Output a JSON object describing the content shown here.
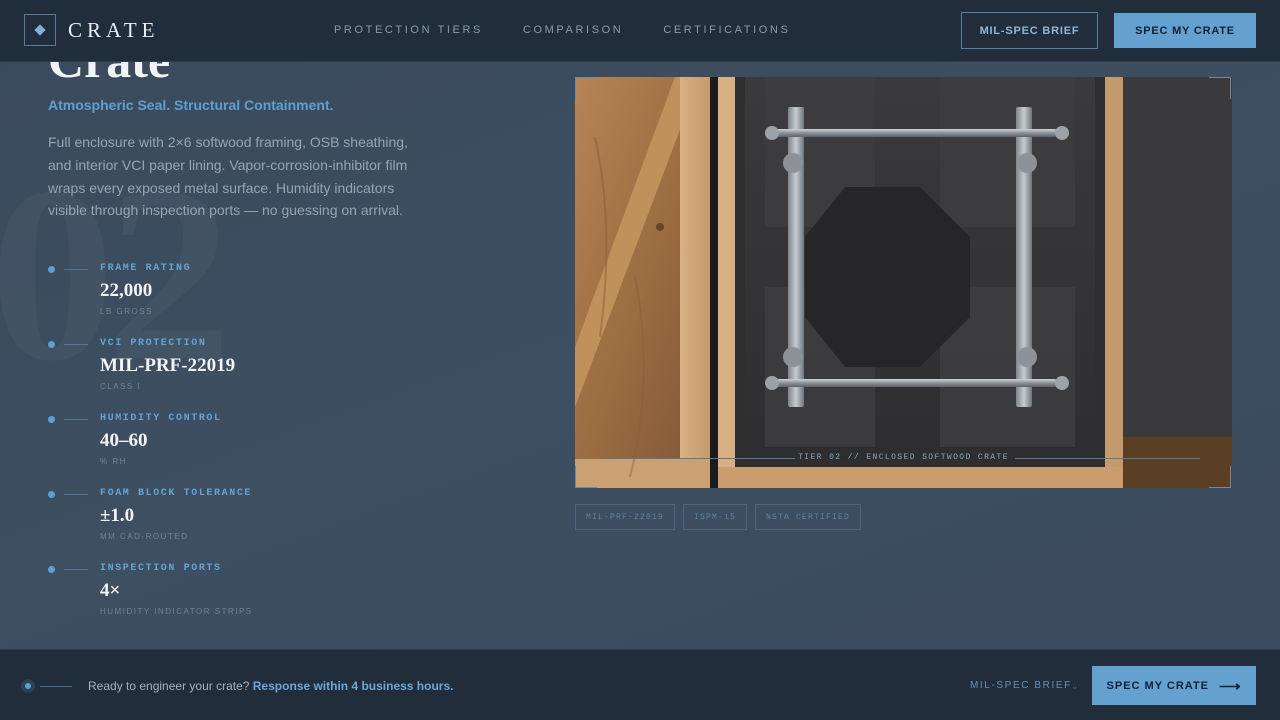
{
  "brand": {
    "name": "CRATE"
  },
  "nav": {
    "items": [
      "PROTECTION TIERS",
      "COMPARISON",
      "CERTIFICATIONS"
    ]
  },
  "header": {
    "brief_label": "MIL-SPEC BRIEF",
    "cta_label": "SPEC MY CRATE"
  },
  "hero": {
    "title": "Crate",
    "subtitle": "Atmospheric Seal. Structural Containment.",
    "description": "Full enclosure with 2×6 softwood framing, OSB sheathing, and interior VCI paper lining. Vapor-corrosion-inhibitor film wraps every exposed metal surface. Humidity indicators visible through inspection ports — no guessing on arrival.",
    "bg_number": "02"
  },
  "specs": [
    {
      "label": "FRAME RATING",
      "value": "22,000",
      "unit": "LB GROSS"
    },
    {
      "label": "VCI PROTECTION",
      "value": "MIL-PRF-22019",
      "unit": "CLASS I"
    },
    {
      "label": "HUMIDITY CONTROL",
      "value": "40–60",
      "unit": "% RH"
    },
    {
      "label": "FOAM BLOCK TOLERANCE",
      "value": "±1.0",
      "unit": "MM CAD-ROUTED"
    },
    {
      "label": "INSPECTION PORTS",
      "value": "4×",
      "unit": "HUMIDITY INDICATOR STRIPS"
    }
  ],
  "photo": {
    "caption": "TIER 02 // ENCLOSED SOFTWOOD CRATE"
  },
  "tags": [
    "MIL-PRF-22019",
    "ISPM-15",
    "NSTA CERTIFIED"
  ],
  "footer": {
    "prompt": "Ready to engineer your crate?",
    "highlight": "Response within 4 business hours.",
    "brief_link": "MIL-SPEC BRIEF",
    "cta_label": "SPEC MY CRATE",
    "cta_icon": "arrow-right-icon"
  },
  "colors": {
    "accent": "#65a1cf",
    "header_bg": "#212d3b",
    "page_bg": "#3b4b5e"
  }
}
